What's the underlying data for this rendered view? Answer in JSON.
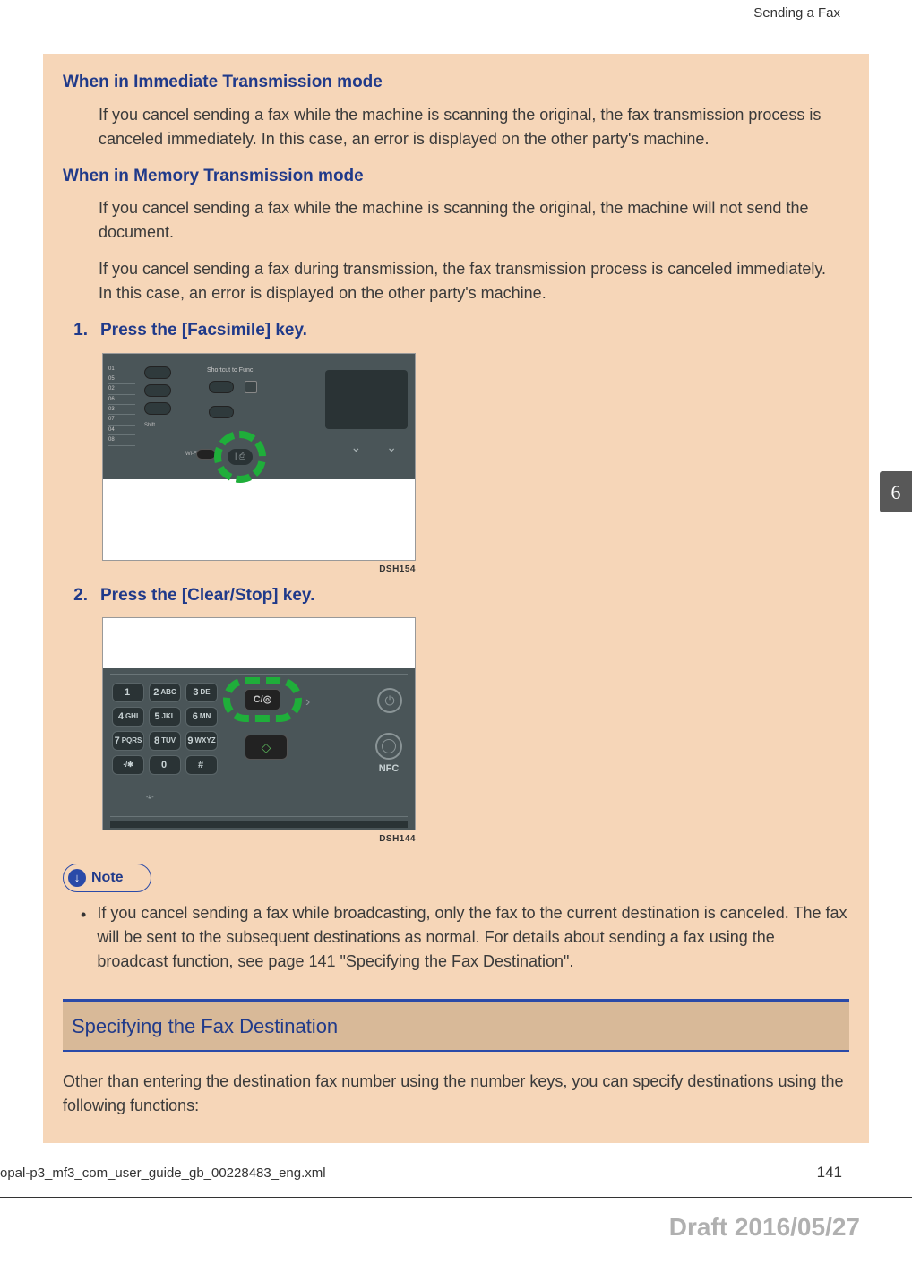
{
  "header": {
    "section": "Sending a Fax"
  },
  "chapter_tab": "6",
  "whenImmediate": {
    "title": "When in Immediate Transmission mode",
    "para": "If you cancel sending a fax while the machine is scanning the original, the fax transmission process is canceled immediately. In this case, an error is displayed on the other party's machine."
  },
  "whenMemory": {
    "title": "When in Memory Transmission mode",
    "para1": "If you cancel sending a fax while the machine is scanning the original, the machine will not send the document.",
    "para2": "If you cancel sending a fax during transmission, the fax transmission process is canceled immediately. In this case, an error is displayed on the other party's machine."
  },
  "steps": {
    "s1": {
      "num": "1.",
      "text": "Press the [Facsimile] key."
    },
    "s2": {
      "num": "2.",
      "text": "Press the [Clear/Stop] key."
    }
  },
  "figures": {
    "f1": {
      "label": "DSH154",
      "shortcut": "Shortcut to Func.",
      "shift": "Shift",
      "wifi": "Wi-Fi D",
      "sideLabels": [
        "01",
        "05",
        "02",
        "06",
        "03",
        "07",
        "04",
        "08"
      ],
      "highlight_icon": "fax-icon"
    },
    "f2": {
      "label": "DSH144",
      "keypad": [
        "1",
        "2 ABC",
        "3 DE",
        "4 GHI",
        "5 JKL",
        "6 MN",
        "7 PQRS",
        "8 TUV",
        "9 WXYZ",
        "·/*",
        "0",
        "#"
      ],
      "clear": "C/◎",
      "nfc": "NFC",
      "start": "◇",
      "sym": "-#-"
    }
  },
  "note": {
    "label": "Note",
    "bullet": "If you cancel sending a fax while broadcasting, only the fax to the current destination is canceled. The fax will be sent to the subsequent destinations as normal. For details about sending a fax using the broadcast function, see page 141 \"Specifying the Fax Destination\"."
  },
  "section2": {
    "title": "Specifying the Fax Destination",
    "para": "Other than entering the destination fax number using the number keys, you can specify destinations using the following functions:"
  },
  "footer": {
    "file": "opal-p3_mf3_com_user_guide_gb_00228483_eng.xml",
    "page": "141",
    "draft": "Draft 2016/05/27"
  }
}
